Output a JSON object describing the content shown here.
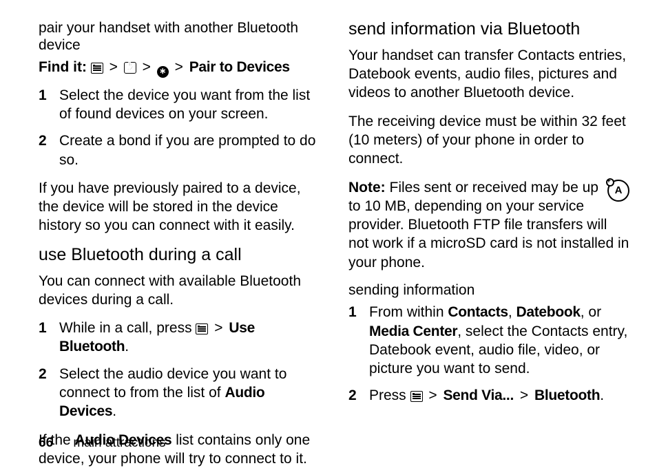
{
  "leftColumn": {
    "section1": {
      "heading": "pair your handset with another Bluetooth device",
      "findItLabel": "Find it:",
      "findItTail": "Pair to Devices",
      "steps": [
        "Select the device you want from the list of found devices on your screen.",
        "Create a bond if you are prompted to do so."
      ],
      "para": "If you have previously paired to a device, the device will be stored in the device history so you can connect with it easily."
    },
    "section2": {
      "heading": "use Bluetooth during a call",
      "intro": "You can connect with available Bluetooth devices during a call.",
      "step1_pre": "While in a call, press ",
      "step1_tail": "Use Bluetooth",
      "step2_pre": "Select the audio device you want to connect to from the list of ",
      "step2_tail": "Audio Devices",
      "outro_pre": "If the ",
      "outro_mid": "Audio Devices",
      "outro_post": " list contains only one device, your phone will try to connect to it."
    }
  },
  "rightColumn": {
    "section1": {
      "heading": "send information via Bluetooth",
      "para1": "Your handset can transfer Contacts entries, Datebook events, audio files, pictures and videos to another Bluetooth device.",
      "para2": "The receiving device must be within 32 feet (10 meters) of your phone in order to connect.",
      "noteLabel": "Note:",
      "noteBody": " Files sent or received may be up to 10 MB, depending on your service provider. Bluetooth FTP file transfers will not work if a microSD card is not installed in your phone.",
      "iconA": "A"
    },
    "section2": {
      "heading": "sending information",
      "step1_pre": "From within ",
      "step1_c1": "Contacts",
      "step1_s1": ", ",
      "step1_c2": "Datebook",
      "step1_s2": ", or ",
      "step1_c3": "Media Center",
      "step1_post": ", select the Contacts entry, Datebook event, audio file, video, or picture you want to send.",
      "step2_pre": "Press ",
      "step2_mid": "Send Via...",
      "step2_tail": "Bluetooth"
    }
  },
  "footer": {
    "page": "66",
    "chapter": "main attractions"
  },
  "glyphs": {
    "gt": ">",
    "bt": "∗",
    "period": "."
  }
}
